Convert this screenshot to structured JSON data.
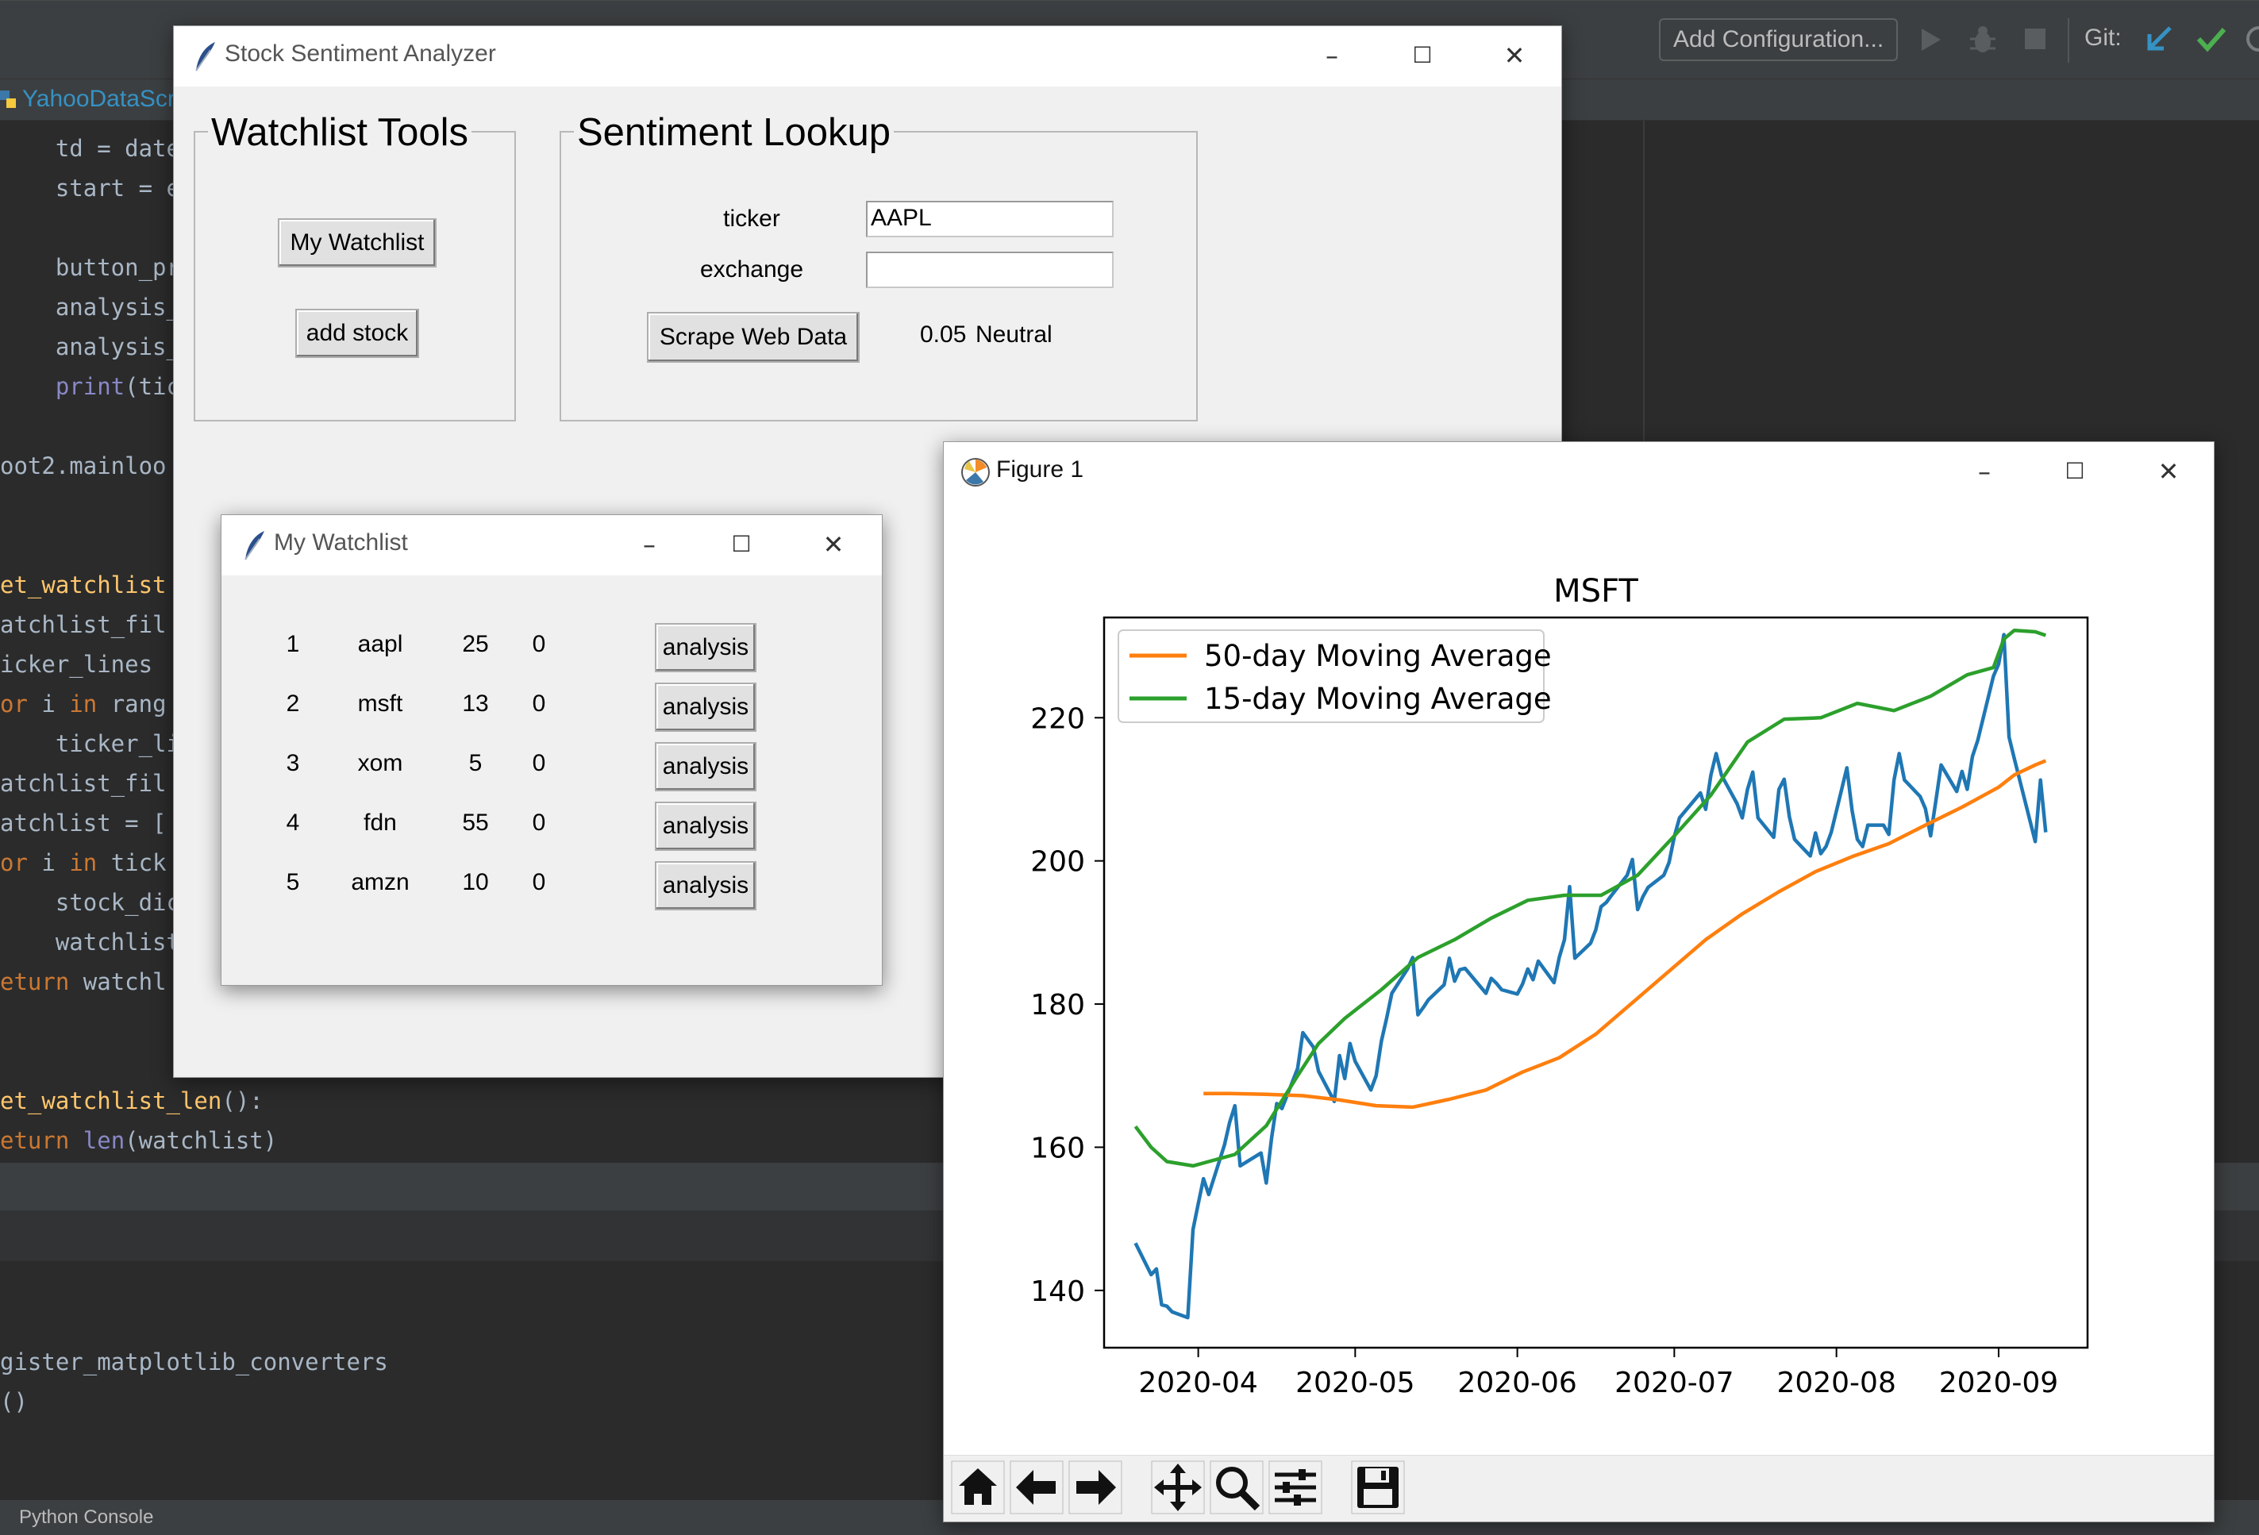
{
  "ide": {
    "config_button": "Add Configuration...",
    "git_label": "Git:",
    "file_tab": "YahooDataScra",
    "console_tab": "Python Console",
    "code_lines": [
      {
        "tokens": [
          {
            "t": "    td = date",
            "c": "plain"
          }
        ]
      },
      {
        "tokens": [
          {
            "t": "    start = e",
            "c": "plain"
          }
        ]
      },
      {
        "tokens": [
          {
            "t": "",
            "c": "plain"
          }
        ]
      },
      {
        "tokens": [
          {
            "t": "    button_pr",
            "c": "plain"
          }
        ]
      },
      {
        "tokens": [
          {
            "t": "    analysis_",
            "c": "plain"
          }
        ]
      },
      {
        "tokens": [
          {
            "t": "    analysis_",
            "c": "plain"
          }
        ]
      },
      {
        "tokens": [
          {
            "t": "    ",
            "c": "plain"
          },
          {
            "t": "print",
            "c": "bi"
          },
          {
            "t": "(tic",
            "c": "plain"
          }
        ]
      },
      {
        "tokens": [
          {
            "t": "",
            "c": "plain"
          }
        ]
      },
      {
        "tokens": [
          {
            "t": "oot2.mainloo",
            "c": "plain"
          }
        ]
      },
      {
        "tokens": [
          {
            "t": "",
            "c": "plain"
          }
        ]
      },
      {
        "tokens": [
          {
            "t": "",
            "c": "plain"
          }
        ]
      },
      {
        "tokens": [
          {
            "t": "et_watchlist",
            "c": "fn"
          }
        ]
      },
      {
        "tokens": [
          {
            "t": "atchlist_fil",
            "c": "plain"
          }
        ]
      },
      {
        "tokens": [
          {
            "t": "icker_lines ",
            "c": "plain"
          }
        ]
      },
      {
        "tokens": [
          {
            "t": "or",
            "c": "kw"
          },
          {
            "t": " i ",
            "c": "plain"
          },
          {
            "t": "in",
            "c": "kw"
          },
          {
            "t": " rang",
            "c": "plain"
          }
        ]
      },
      {
        "tokens": [
          {
            "t": "    ticker_li",
            "c": "plain"
          }
        ]
      },
      {
        "tokens": [
          {
            "t": "atchlist_fil",
            "c": "plain"
          }
        ]
      },
      {
        "tokens": [
          {
            "t": "atchlist = [",
            "c": "plain"
          }
        ]
      },
      {
        "tokens": [
          {
            "t": "or",
            "c": "kw"
          },
          {
            "t": " i ",
            "c": "plain"
          },
          {
            "t": "in",
            "c": "kw"
          },
          {
            "t": " tick",
            "c": "plain"
          }
        ]
      },
      {
        "tokens": [
          {
            "t": "    stock_dic",
            "c": "plain"
          }
        ]
      },
      {
        "tokens": [
          {
            "t": "    watchlist",
            "c": "plain"
          }
        ]
      },
      {
        "tokens": [
          {
            "t": "eturn",
            "c": "kw"
          },
          {
            "t": " watchl",
            "c": "plain"
          }
        ]
      },
      {
        "tokens": [
          {
            "t": "",
            "c": "plain"
          }
        ]
      },
      {
        "tokens": [
          {
            "t": "",
            "c": "plain"
          }
        ]
      },
      {
        "tokens": [
          {
            "t": "et_watchlist_len",
            "c": "fn"
          },
          {
            "t": "():",
            "c": "plain"
          }
        ]
      },
      {
        "tokens": [
          {
            "t": "eturn",
            "c": "kw"
          },
          {
            "t": " ",
            "c": "plain"
          },
          {
            "t": "len",
            "c": "bi"
          },
          {
            "t": "(watchlist)",
            "c": "plain"
          }
        ]
      }
    ],
    "console_lines": [
      "gister_matplotlib_converters",
      "()"
    ]
  },
  "main_window": {
    "title": "Stock Sentiment Analyzer",
    "watchlist_tools": {
      "title": "Watchlist Tools",
      "my_watchlist_button": "My Watchlist",
      "add_stock_button": "add stock"
    },
    "sentiment_lookup": {
      "title": "Sentiment Lookup",
      "ticker_label": "ticker",
      "ticker_value": "AAPL",
      "exchange_label": "exchange",
      "exchange_value": "",
      "scrape_button": "Scrape Web Data",
      "score": "0.05",
      "sentiment": "Neutral"
    }
  },
  "watchlist_window": {
    "title": "My Watchlist",
    "button_label": "analysis",
    "rows": [
      {
        "index": "1",
        "ticker": "aapl",
        "shares": "25",
        "value": "0"
      },
      {
        "index": "2",
        "ticker": "msft",
        "shares": "13",
        "value": "0"
      },
      {
        "index": "3",
        "ticker": "xom",
        "shares": "5",
        "value": "0"
      },
      {
        "index": "4",
        "ticker": "fdn",
        "shares": "55",
        "value": "0"
      },
      {
        "index": "5",
        "ticker": "amzn",
        "shares": "10",
        "value": "0"
      }
    ]
  },
  "figure_window": {
    "title": "Figure 1",
    "toolbar_icons": [
      "home-icon",
      "back-arrow-icon",
      "forward-arrow-icon",
      "pan-icon",
      "zoom-icon",
      "configure-subplots-icon",
      "save-icon"
    ]
  },
  "chart_data": {
    "type": "line",
    "title": "MSFT",
    "xlabel": "",
    "ylabel": "",
    "x_ticks": [
      "2020-04",
      "2020-05",
      "2020-06",
      "2020-07",
      "2020-08",
      "2020-09"
    ],
    "y_ticks": [
      140,
      160,
      180,
      200,
      220
    ],
    "xlim": [
      "2020-03-14",
      "2020-09-18"
    ],
    "ylim": [
      132,
      234
    ],
    "legend_position": "upper-left",
    "colors": {
      "price": "#1f77b4",
      "ma50": "#ff7f0e",
      "ma15": "#2ca02c"
    },
    "series": [
      {
        "name": "",
        "key": "price",
        "points": [
          [
            "2020-03-20",
            146.6
          ],
          [
            "2020-03-23",
            142.2
          ],
          [
            "2020-03-24",
            143.0
          ],
          [
            "2020-03-25",
            138.0
          ],
          [
            "2020-03-26",
            137.8
          ],
          [
            "2020-03-27",
            137.0
          ],
          [
            "2020-03-30",
            136.2
          ],
          [
            "2020-03-31",
            148.5
          ],
          [
            "2020-04-01",
            152.1
          ],
          [
            "2020-04-02",
            155.6
          ],
          [
            "2020-04-03",
            153.4
          ],
          [
            "2020-04-06",
            160.3
          ],
          [
            "2020-04-07",
            163.5
          ],
          [
            "2020-04-08",
            165.8
          ],
          [
            "2020-04-09",
            157.4
          ],
          [
            "2020-04-13",
            159.2
          ],
          [
            "2020-04-14",
            155.0
          ],
          [
            "2020-04-15",
            161.2
          ],
          [
            "2020-04-16",
            166.1
          ],
          [
            "2020-04-17",
            165.4
          ],
          [
            "2020-04-20",
            171.0
          ],
          [
            "2020-04-21",
            176.0
          ],
          [
            "2020-04-22",
            175.0
          ],
          [
            "2020-04-23",
            174.0
          ],
          [
            "2020-04-24",
            170.6
          ],
          [
            "2020-04-27",
            166.4
          ],
          [
            "2020-04-28",
            172.8
          ],
          [
            "2020-04-29",
            169.6
          ],
          [
            "2020-04-30",
            174.5
          ],
          [
            "2020-05-01",
            172.0
          ],
          [
            "2020-05-04",
            168.0
          ],
          [
            "2020-05-05",
            170.0
          ],
          [
            "2020-05-06",
            174.8
          ],
          [
            "2020-05-07",
            178.0
          ],
          [
            "2020-05-08",
            181.5
          ],
          [
            "2020-05-11",
            184.9
          ],
          [
            "2020-05-12",
            186.5
          ],
          [
            "2020-05-13",
            178.5
          ],
          [
            "2020-05-14",
            179.5
          ],
          [
            "2020-05-15",
            180.6
          ],
          [
            "2020-05-18",
            182.7
          ],
          [
            "2020-05-19",
            186.4
          ],
          [
            "2020-05-20",
            183.2
          ],
          [
            "2020-05-21",
            184.8
          ],
          [
            "2020-05-22",
            185.0
          ],
          [
            "2020-05-26",
            181.5
          ],
          [
            "2020-05-27",
            183.6
          ],
          [
            "2020-05-28",
            182.9
          ],
          [
            "2020-05-29",
            182.0
          ],
          [
            "2020-06-01",
            181.4
          ],
          [
            "2020-06-02",
            182.8
          ],
          [
            "2020-06-03",
            184.9
          ],
          [
            "2020-06-04",
            183.4
          ],
          [
            "2020-06-05",
            186.0
          ],
          [
            "2020-06-08",
            183.0
          ],
          [
            "2020-06-09",
            186.5
          ],
          [
            "2020-06-10",
            189.0
          ],
          [
            "2020-06-11",
            196.4
          ],
          [
            "2020-06-12",
            186.4
          ],
          [
            "2020-06-15",
            188.5
          ],
          [
            "2020-06-16",
            190.4
          ],
          [
            "2020-06-17",
            193.6
          ],
          [
            "2020-06-18",
            194.2
          ],
          [
            "2020-06-19",
            195.2
          ],
          [
            "2020-06-22",
            198.0
          ],
          [
            "2020-06-23",
            200.2
          ],
          [
            "2020-06-24",
            193.2
          ],
          [
            "2020-06-25",
            195.0
          ],
          [
            "2020-06-26",
            196.3
          ],
          [
            "2020-06-29",
            198.0
          ],
          [
            "2020-06-30",
            199.8
          ],
          [
            "2020-07-01",
            203.4
          ],
          [
            "2020-07-02",
            206.0
          ],
          [
            "2020-07-06",
            209.5
          ],
          [
            "2020-07-07",
            207.2
          ],
          [
            "2020-07-08",
            212.0
          ],
          [
            "2020-07-09",
            215.0
          ],
          [
            "2020-07-10",
            212.0
          ],
          [
            "2020-07-13",
            208.0
          ],
          [
            "2020-07-14",
            206.0
          ],
          [
            "2020-07-15",
            210.0
          ],
          [
            "2020-07-16",
            212.4
          ],
          [
            "2020-07-17",
            206.0
          ],
          [
            "2020-07-20",
            203.3
          ],
          [
            "2020-07-21",
            210.0
          ],
          [
            "2020-07-22",
            211.4
          ],
          [
            "2020-07-23",
            206.2
          ],
          [
            "2020-07-24",
            203.0
          ],
          [
            "2020-07-27",
            200.7
          ],
          [
            "2020-07-28",
            203.9
          ],
          [
            "2020-07-29",
            201.0
          ],
          [
            "2020-07-30",
            202.0
          ],
          [
            "2020-07-31",
            204.0
          ],
          [
            "2020-08-03",
            213.0
          ],
          [
            "2020-08-04",
            207.0
          ],
          [
            "2020-08-05",
            203.0
          ],
          [
            "2020-08-06",
            202.0
          ],
          [
            "2020-08-07",
            205.0
          ],
          [
            "2020-08-10",
            205.0
          ],
          [
            "2020-08-11",
            203.7
          ],
          [
            "2020-08-12",
            211.3
          ],
          [
            "2020-08-13",
            215.0
          ],
          [
            "2020-08-14",
            211.3
          ],
          [
            "2020-08-17",
            209.0
          ],
          [
            "2020-08-18",
            207.3
          ],
          [
            "2020-08-19",
            203.5
          ],
          [
            "2020-08-20",
            208.4
          ],
          [
            "2020-08-21",
            213.4
          ],
          [
            "2020-08-24",
            209.7
          ],
          [
            "2020-08-25",
            212.5
          ],
          [
            "2020-08-26",
            210.0
          ],
          [
            "2020-08-27",
            214.6
          ],
          [
            "2020-08-28",
            216.8
          ],
          [
            "2020-08-31",
            225.8
          ],
          [
            "2020-09-01",
            227.5
          ],
          [
            "2020-09-02",
            231.6
          ],
          [
            "2020-09-03",
            217.3
          ],
          [
            "2020-09-04",
            214.3
          ],
          [
            "2020-09-08",
            202.7
          ],
          [
            "2020-09-09",
            211.3
          ],
          [
            "2020-09-10",
            204.0
          ]
        ]
      },
      {
        "name": "50-day Moving Average",
        "key": "ma50",
        "points": [
          [
            "2020-04-02",
            167.5
          ],
          [
            "2020-04-07",
            167.5
          ],
          [
            "2020-04-14",
            167.4
          ],
          [
            "2020-04-21",
            167.2
          ],
          [
            "2020-04-28",
            166.6
          ],
          [
            "2020-05-05",
            165.8
          ],
          [
            "2020-05-12",
            165.6
          ],
          [
            "2020-05-19",
            166.7
          ],
          [
            "2020-05-26",
            168.0
          ],
          [
            "2020-06-02",
            170.5
          ],
          [
            "2020-06-09",
            172.5
          ],
          [
            "2020-06-16",
            175.8
          ],
          [
            "2020-06-23",
            180.2
          ],
          [
            "2020-06-30",
            184.6
          ],
          [
            "2020-07-07",
            189.0
          ],
          [
            "2020-07-14",
            192.6
          ],
          [
            "2020-07-21",
            195.7
          ],
          [
            "2020-07-28",
            198.5
          ],
          [
            "2020-08-04",
            200.6
          ],
          [
            "2020-08-11",
            202.4
          ],
          [
            "2020-08-18",
            205.0
          ],
          [
            "2020-08-25",
            207.5
          ],
          [
            "2020-09-01",
            210.3
          ],
          [
            "2020-09-04",
            212.0
          ],
          [
            "2020-09-08",
            213.4
          ],
          [
            "2020-09-10",
            214.0
          ]
        ]
      },
      {
        "name": "15-day Moving Average",
        "key": "ma15",
        "points": [
          [
            "2020-03-20",
            162.9
          ],
          [
            "2020-03-23",
            160.0
          ],
          [
            "2020-03-26",
            158.0
          ],
          [
            "2020-03-31",
            157.4
          ],
          [
            "2020-04-03",
            158.0
          ],
          [
            "2020-04-08",
            159.0
          ],
          [
            "2020-04-14",
            163.0
          ],
          [
            "2020-04-20",
            170.0
          ],
          [
            "2020-04-24",
            174.5
          ],
          [
            "2020-04-29",
            178.0
          ],
          [
            "2020-05-06",
            182.0
          ],
          [
            "2020-05-13",
            186.5
          ],
          [
            "2020-05-20",
            189.0
          ],
          [
            "2020-05-27",
            192.0
          ],
          [
            "2020-06-03",
            194.5
          ],
          [
            "2020-06-10",
            195.2
          ],
          [
            "2020-06-17",
            195.2
          ],
          [
            "2020-06-24",
            198.0
          ],
          [
            "2020-07-01",
            203.5
          ],
          [
            "2020-07-08",
            209.2
          ],
          [
            "2020-07-15",
            216.6
          ],
          [
            "2020-07-22",
            219.8
          ],
          [
            "2020-07-29",
            220.0
          ],
          [
            "2020-08-05",
            222.0
          ],
          [
            "2020-08-12",
            221.0
          ],
          [
            "2020-08-19",
            223.0
          ],
          [
            "2020-08-26",
            226.0
          ],
          [
            "2020-08-31",
            227.0
          ],
          [
            "2020-09-02",
            231.0
          ],
          [
            "2020-09-04",
            232.2
          ],
          [
            "2020-09-08",
            232.0
          ],
          [
            "2020-09-10",
            231.5
          ]
        ]
      }
    ]
  }
}
